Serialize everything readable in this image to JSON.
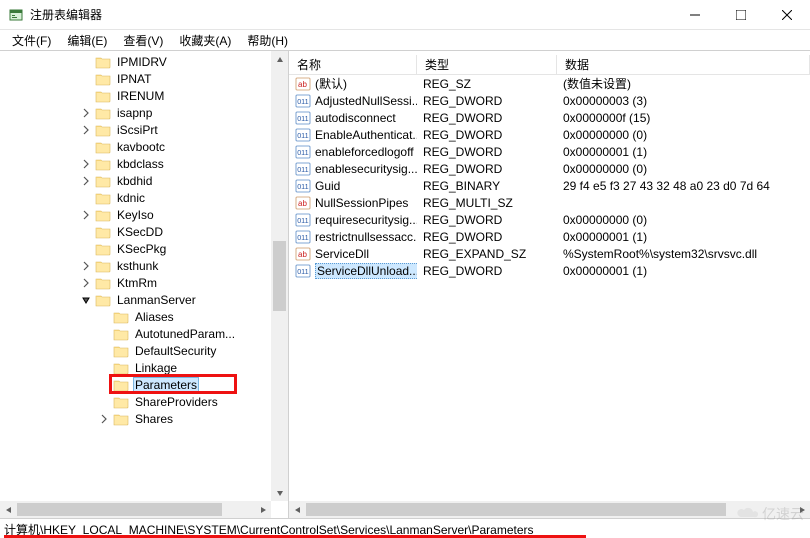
{
  "window": {
    "title": "注册表编辑器"
  },
  "menu": {
    "file": "文件(F)",
    "edit": "编辑(E)",
    "view": "查看(V)",
    "favorites": "收藏夹(A)",
    "help": "帮助(H)"
  },
  "list": {
    "columns": {
      "name": "名称",
      "type": "类型",
      "data": "数据"
    },
    "rows": [
      {
        "icon": "sz",
        "name": "(默认)",
        "type": "REG_SZ",
        "data": "(数值未设置)"
      },
      {
        "icon": "dw",
        "name": "AdjustedNullSessi...",
        "type": "REG_DWORD",
        "data": "0x00000003 (3)"
      },
      {
        "icon": "dw",
        "name": "autodisconnect",
        "type": "REG_DWORD",
        "data": "0x0000000f (15)"
      },
      {
        "icon": "dw",
        "name": "EnableAuthenticat...",
        "type": "REG_DWORD",
        "data": "0x00000000 (0)"
      },
      {
        "icon": "dw",
        "name": "enableforcedlogoff",
        "type": "REG_DWORD",
        "data": "0x00000001 (1)"
      },
      {
        "icon": "dw",
        "name": "enablesecuritysig...",
        "type": "REG_DWORD",
        "data": "0x00000000 (0)"
      },
      {
        "icon": "dw",
        "name": "Guid",
        "type": "REG_BINARY",
        "data": "29 f4 e5 f3 27 43 32 48 a0 23 d0 7d 64"
      },
      {
        "icon": "sz",
        "name": "NullSessionPipes",
        "type": "REG_MULTI_SZ",
        "data": ""
      },
      {
        "icon": "dw",
        "name": "requiresecuritysig...",
        "type": "REG_DWORD",
        "data": "0x00000000 (0)"
      },
      {
        "icon": "dw",
        "name": "restrictnullsessacc...",
        "type": "REG_DWORD",
        "data": "0x00000001 (1)"
      },
      {
        "icon": "sz",
        "name": "ServiceDll",
        "type": "REG_EXPAND_SZ",
        "data": "%SystemRoot%\\system32\\srvsvc.dll"
      },
      {
        "icon": "dw",
        "name": "ServiceDllUnload...",
        "type": "REG_DWORD",
        "data": "0x00000001 (1)",
        "selected": true
      }
    ]
  },
  "tree": {
    "items": [
      {
        "indent": 4,
        "exp": "",
        "label": "IPMIDRV"
      },
      {
        "indent": 4,
        "exp": "",
        "label": "IPNAT"
      },
      {
        "indent": 4,
        "exp": "",
        "label": "IRENUM"
      },
      {
        "indent": 4,
        "exp": "closed",
        "label": "isapnp"
      },
      {
        "indent": 4,
        "exp": "closed",
        "label": "iScsiPrt"
      },
      {
        "indent": 4,
        "exp": "",
        "label": "kavbootc"
      },
      {
        "indent": 4,
        "exp": "closed",
        "label": "kbdclass"
      },
      {
        "indent": 4,
        "exp": "closed",
        "label": "kbdhid"
      },
      {
        "indent": 4,
        "exp": "",
        "label": "kdnic"
      },
      {
        "indent": 4,
        "exp": "closed",
        "label": "KeyIso"
      },
      {
        "indent": 4,
        "exp": "",
        "label": "KSecDD"
      },
      {
        "indent": 4,
        "exp": "",
        "label": "KSecPkg"
      },
      {
        "indent": 4,
        "exp": "closed",
        "label": "ksthunk"
      },
      {
        "indent": 4,
        "exp": "closed",
        "label": "KtmRm"
      },
      {
        "indent": 4,
        "exp": "open",
        "label": "LanmanServer"
      },
      {
        "indent": 5,
        "exp": "",
        "label": "Aliases"
      },
      {
        "indent": 5,
        "exp": "",
        "label": "AutotunedParam..."
      },
      {
        "indent": 5,
        "exp": "",
        "label": "DefaultSecurity"
      },
      {
        "indent": 5,
        "exp": "",
        "label": "Linkage"
      },
      {
        "indent": 5,
        "exp": "",
        "label": "Parameters",
        "selected": true,
        "highlight": true
      },
      {
        "indent": 5,
        "exp": "",
        "label": "ShareProviders"
      },
      {
        "indent": 5,
        "exp": "closed",
        "label": "Shares"
      }
    ]
  },
  "status": {
    "path": "计算机\\HKEY_LOCAL_MACHINE\\SYSTEM\\CurrentControlSet\\Services\\LanmanServer\\Parameters"
  },
  "watermark": "亿速云"
}
